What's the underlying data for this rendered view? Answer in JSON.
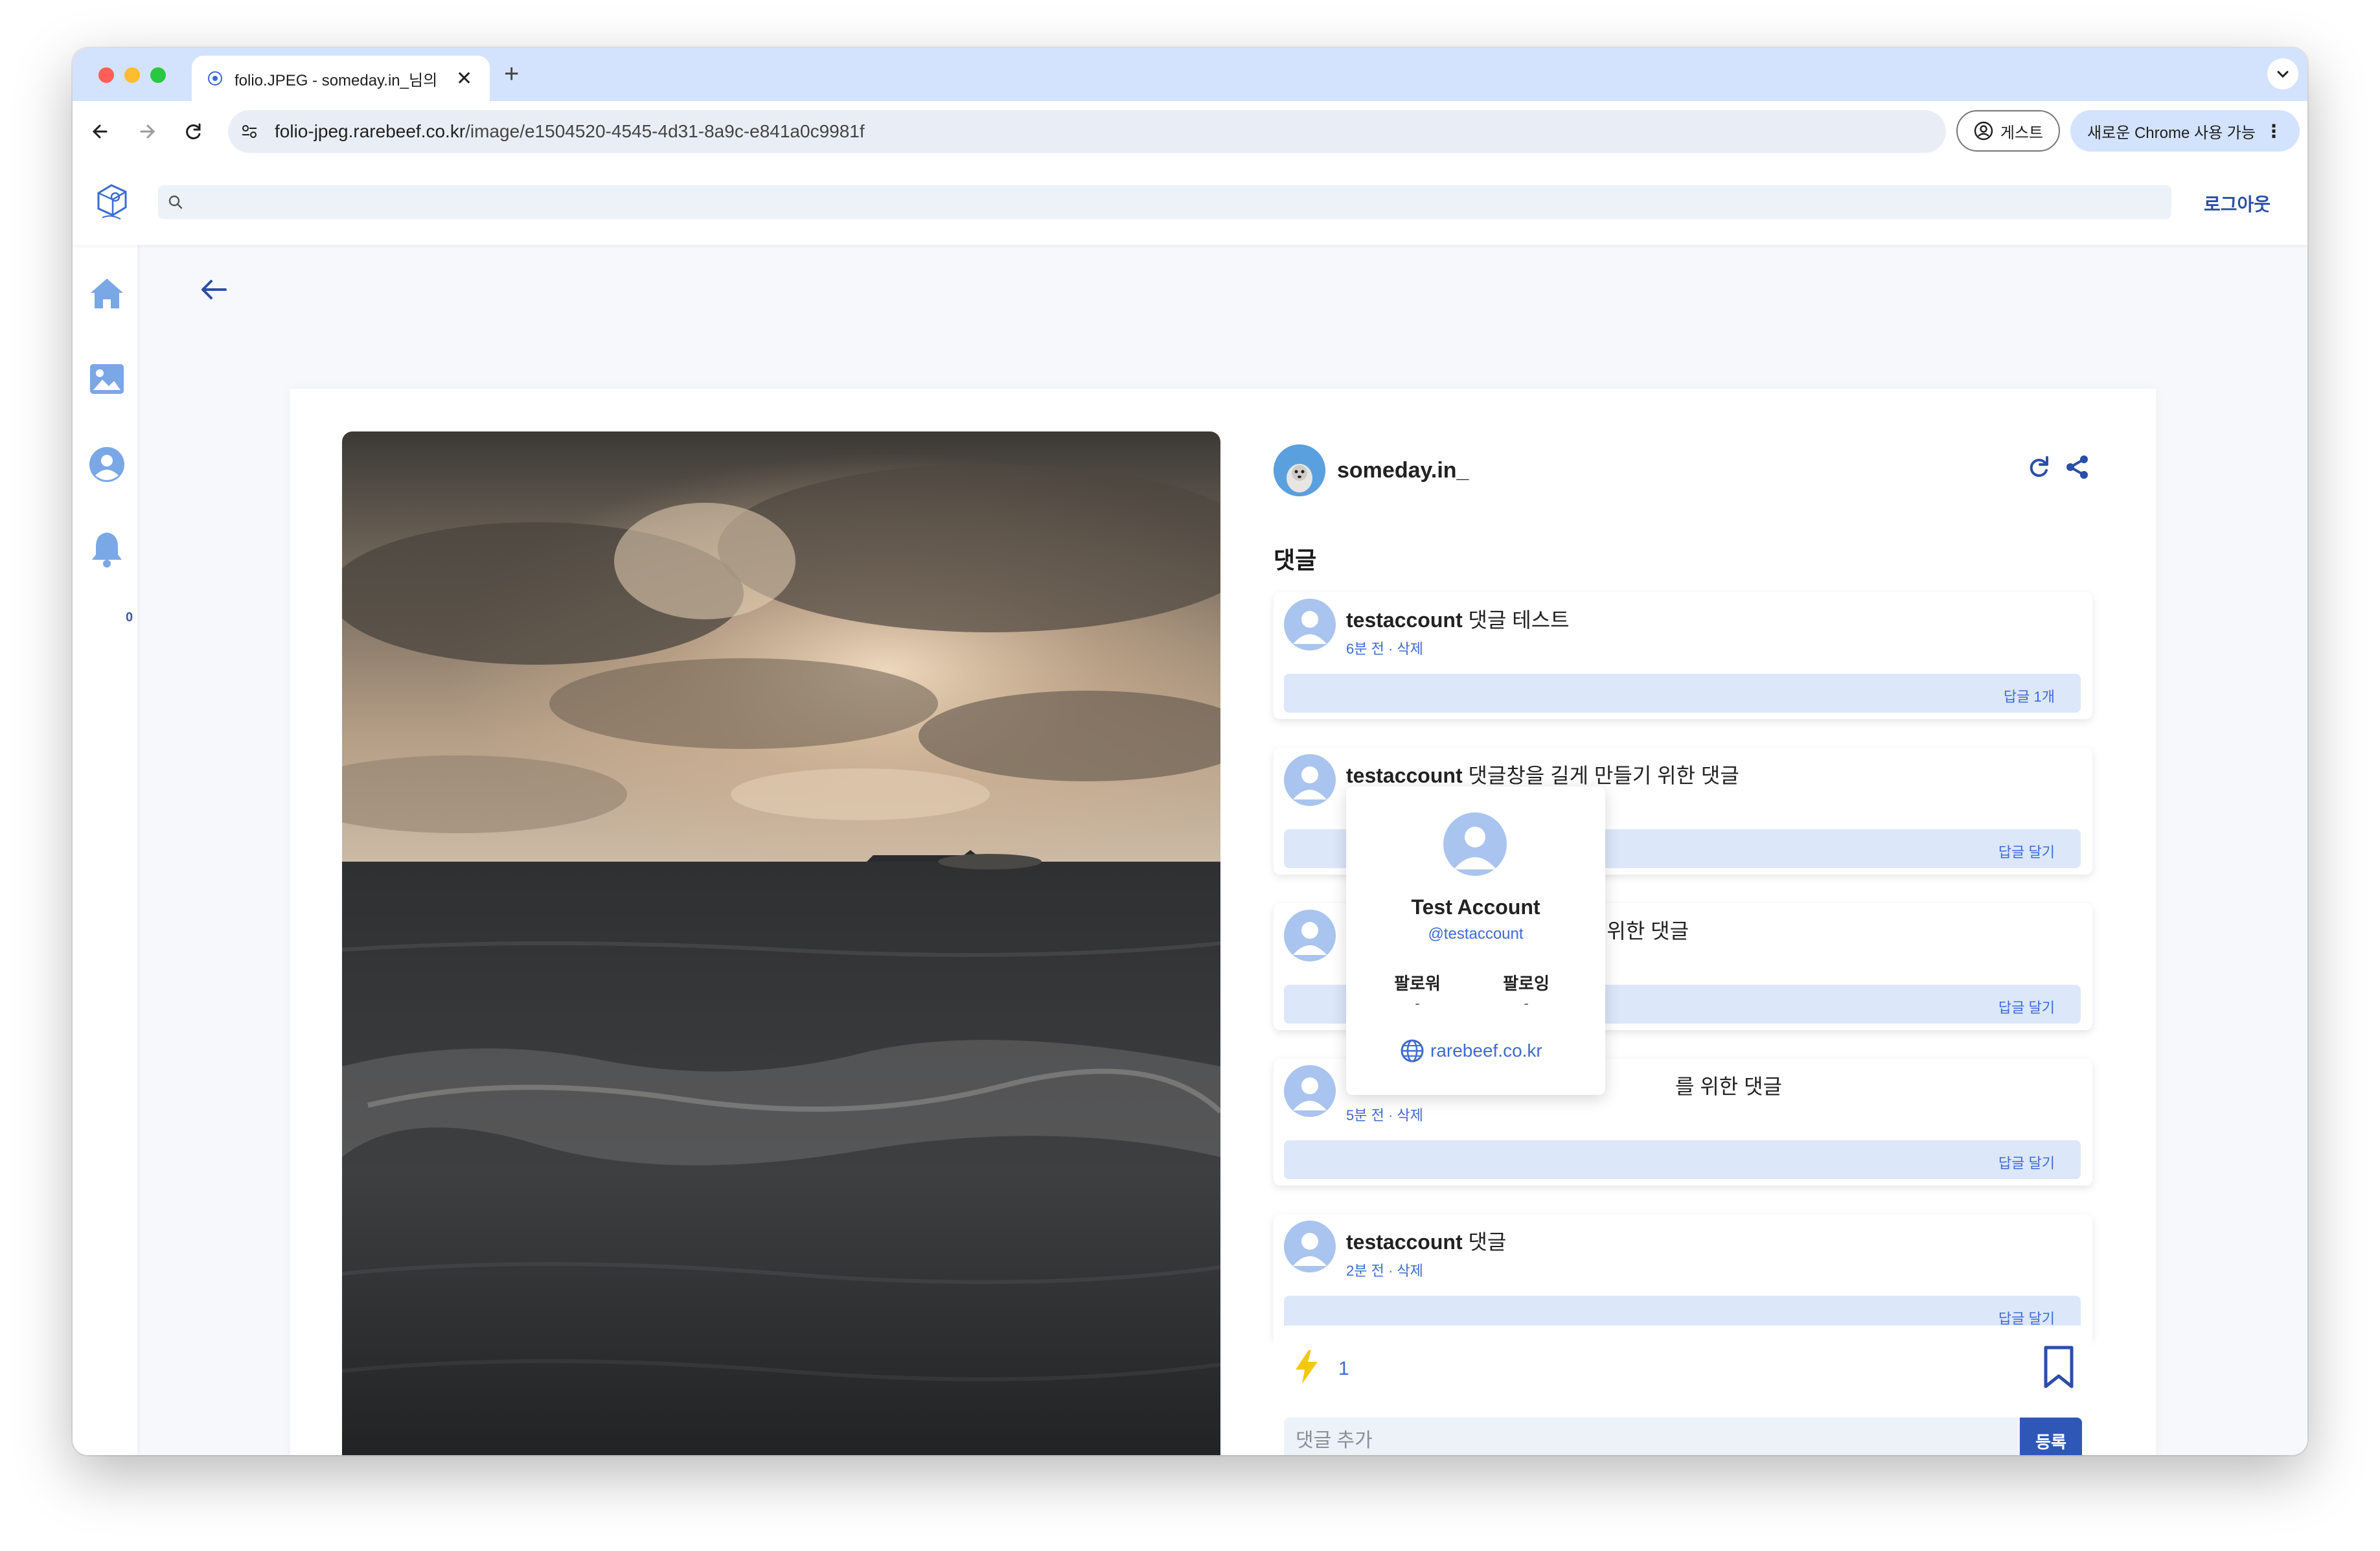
{
  "browser": {
    "tab_title": "folio.JPEG - someday.in_님의",
    "url_host": "folio-jpeg.rarebeef.co.kr",
    "url_path": "/image/e1504520-4545-4d31-8a9c-e841a0c9981f",
    "guest_label": "게스트",
    "update_label": "새로운 Chrome 사용 가능"
  },
  "header": {
    "search_placeholder": "",
    "logout_label": "로그아웃"
  },
  "sidebar": {
    "notification_count": "0"
  },
  "post": {
    "author": "someday.in_",
    "comments_title": "댓글",
    "like_count": "1",
    "comment_placeholder": "댓글 추가",
    "submit_label": "등록"
  },
  "comments": [
    {
      "user": "testaccount",
      "text": " 댓글 테스트",
      "meta": "6분 전 · 삭제",
      "reply": "답글 1개"
    },
    {
      "user": "testaccount",
      "text": " 댓글창을 길게 만들기 위한 댓글",
      "meta": "",
      "reply": "답글 달기"
    },
    {
      "user": "",
      "text": "| 만들기 위한 댓글",
      "meta": "",
      "reply": "답글 달기"
    },
    {
      "user": "",
      "text": "를 위한 댓글",
      "meta": "5분 전 · 삭제",
      "reply": "답글 달기"
    },
    {
      "user": "testaccount",
      "text": " 댓글",
      "meta": "2분 전 · 삭제",
      "reply": "답글 달기"
    }
  ],
  "profile_popover": {
    "name": "Test Account",
    "handle": "@testaccount",
    "followers_label": "팔로워",
    "followers_value": "-",
    "following_label": "팔로잉",
    "following_value": "-",
    "website": "rarebeef.co.kr"
  },
  "colors": {
    "accent": "#3d6bd0",
    "sidebar_icon": "#7aa7e6",
    "submit": "#2f57b8",
    "bolt": "#f4c812"
  }
}
